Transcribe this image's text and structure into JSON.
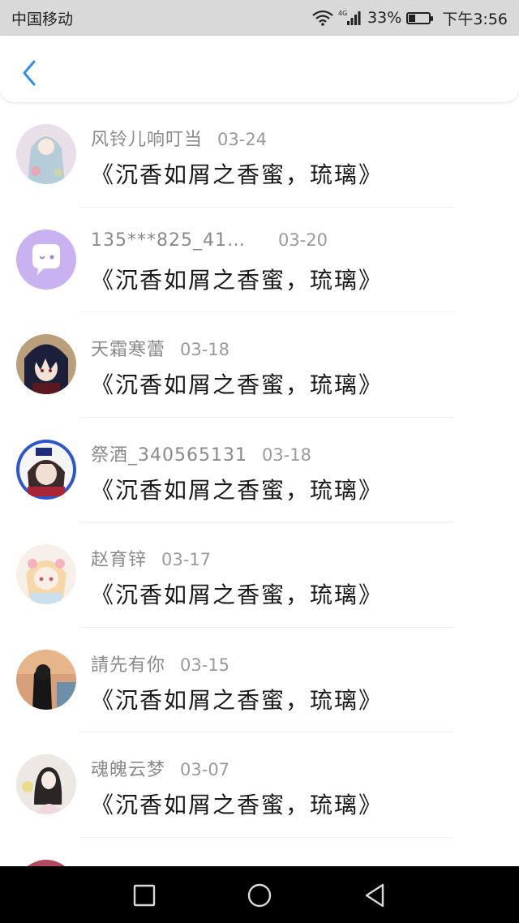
{
  "status_bar": {
    "carrier": "中国移动",
    "network": "4G",
    "battery": "33%",
    "battery_level": 0.33,
    "time": "下午3:56"
  },
  "header": {
    "back_icon": "chevron-left-icon",
    "accent_color": "#2f8fe6"
  },
  "comments": [
    {
      "name": "风铃儿响叮当",
      "date": "03-24",
      "message": "《沉香如屑之香蜜，琉璃》",
      "avatar": "avatar-anime-girl"
    },
    {
      "name": "135***825_41…",
      "date": "03-20",
      "message": "《沉香如屑之香蜜，琉璃》",
      "avatar": "avatar-chat-bubble"
    },
    {
      "name": "天霜寒蕾",
      "date": "03-18",
      "message": "《沉香如屑之香蜜，琉璃》",
      "avatar": "avatar-anime-boy"
    },
    {
      "name": "祭酒_340565131",
      "date": "03-18",
      "message": "《沉香如屑之香蜜，琉璃》",
      "avatar": "avatar-anime-badge"
    },
    {
      "name": "赵育锌",
      "date": "03-17",
      "message": "《沉香如屑之香蜜，琉璃》",
      "avatar": "avatar-cute-girl"
    },
    {
      "name": "請先有你",
      "date": "03-15",
      "message": "《沉香如屑之香蜜，琉璃》",
      "avatar": "avatar-silhouette"
    },
    {
      "name": "魂魄云梦",
      "date": "03-07",
      "message": "《沉香如屑之香蜜，琉璃》",
      "avatar": "avatar-sketch-girl"
    },
    {
      "name": "",
      "date": "",
      "message": "",
      "avatar": "avatar-partial"
    }
  ],
  "navigation_bar": {
    "recent_icon": "square-icon",
    "home_icon": "circle-icon",
    "back_icon": "triangle-back-icon"
  }
}
